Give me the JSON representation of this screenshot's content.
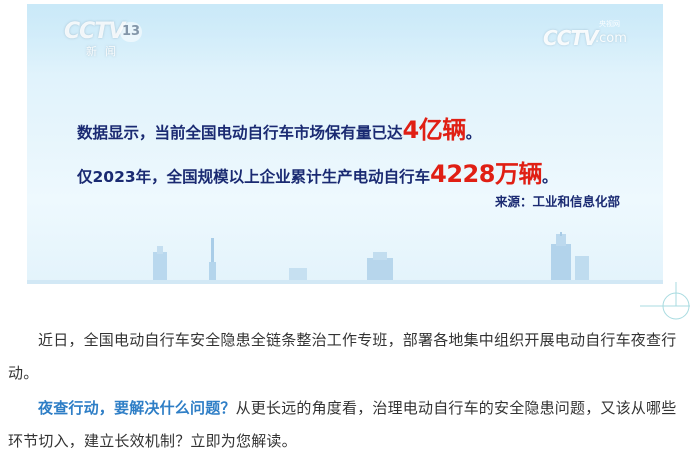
{
  "figure": {
    "logo_left": {
      "mark": "CCTV",
      "channel": "13",
      "sub": "新闻"
    },
    "logo_right": {
      "mark": "CCTV",
      "dotcom": ".com",
      "top": "央视网"
    },
    "line1": {
      "prefix": "数据显示，当前全国电动自行车市场保有量已达",
      "highlight": "4亿辆",
      "suffix": "。"
    },
    "line2": {
      "prefix": "仅2023年，全国规模以上企业累计生产电动自行车",
      "highlight": "4228万辆",
      "suffix": "。"
    },
    "source": "来源：工业和信息化部",
    "colors": {
      "text": "#1a2a72",
      "highlight": "#e01f14",
      "background": "#e3f3fb"
    }
  },
  "article": {
    "para1": "近日，全国电动自行车安全隐患全链条整治工作专班，部署各地集中组织开展电动自行车夜查行动。",
    "para2_lead": "夜查行动，要解决什么问题？",
    "para2_rest": "从更长远的角度看，治理电动自行车的安全隐患问题，又该从哪些环节切入，建立长效机制？立即为您解读。",
    "colors": {
      "text": "#333333",
      "lead": "#2e7ec6"
    }
  },
  "decor": {
    "corner_icon": "plus-circle-icon"
  }
}
